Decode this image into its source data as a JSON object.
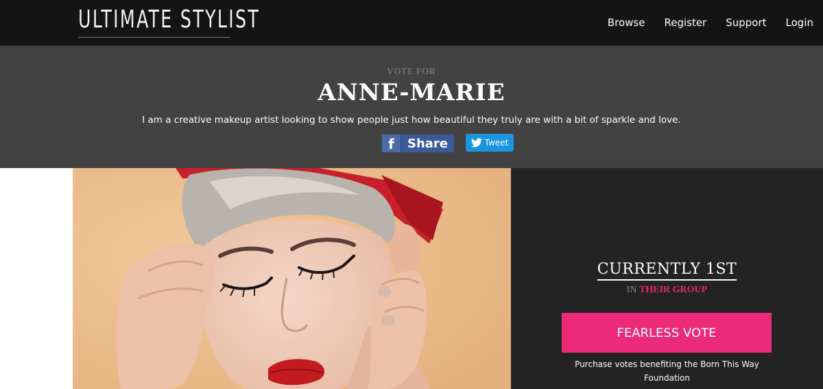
{
  "header": {
    "logo": "ULTIMATE STYLIST",
    "nav": [
      "Browse",
      "Register",
      "Support",
      "Login"
    ]
  },
  "hero": {
    "vote_for": "VOTE FOR",
    "name": "ANNE-MARIE",
    "bio": "I am a creative makeup artist looking to show people just how beautiful they truly are with a bit of sparkle and love.",
    "share_label": "Share",
    "fb_icon_glyph": "f",
    "tweet_label": "Tweet"
  },
  "photo": {
    "icon": "contestant-photo"
  },
  "panel": {
    "rank": "CURRENTLY 1ST",
    "group_prefix": "IN",
    "group_label": "THEIR GROUP",
    "vote_button": "FEARLESS VOTE",
    "purchase_text": "Purchase votes benefiting the Born This Way Foundation"
  },
  "colors": {
    "accent_pink": "#ec2a7a",
    "facebook_blue": "#3b5a9a",
    "twitter_blue": "#1b95e0",
    "topbar": "#141414",
    "hero_band": "#424242",
    "panel": "#232323"
  }
}
